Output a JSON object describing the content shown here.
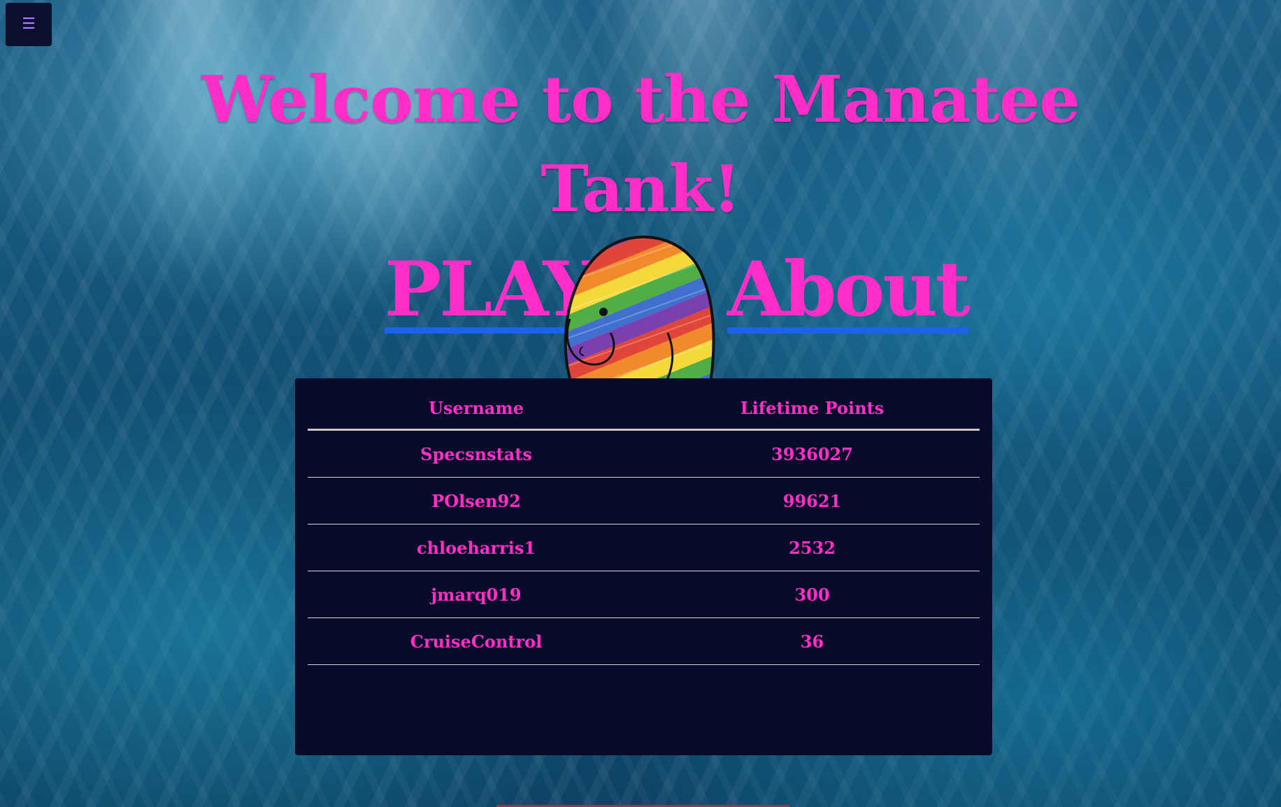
{
  "menu": {
    "icon": "hamburger-icon",
    "glyph": "☰"
  },
  "title": {
    "line1": "Welcome to the Manatee",
    "line2": "Tank!"
  },
  "nav": {
    "play_label": "PLAY!",
    "about_label": "About"
  },
  "mascot": {
    "icon": "rainbow-manatee-drawing"
  },
  "leaderboard": {
    "headers": {
      "username": "Username",
      "points": "Lifetime Points"
    },
    "rows": [
      {
        "username": "Specsnstats",
        "points": "3936027"
      },
      {
        "username": "POlsen92",
        "points": "99621"
      },
      {
        "username": "chloeharris1",
        "points": "2532"
      },
      {
        "username": "jmarq019",
        "points": "300"
      },
      {
        "username": "CruiseControl",
        "points": "36"
      }
    ]
  },
  "colors": {
    "accent": "#ff2dc8",
    "link_underline": "#1b63e8",
    "panel": "#080b2a",
    "menu_icon": "#b07cff"
  }
}
